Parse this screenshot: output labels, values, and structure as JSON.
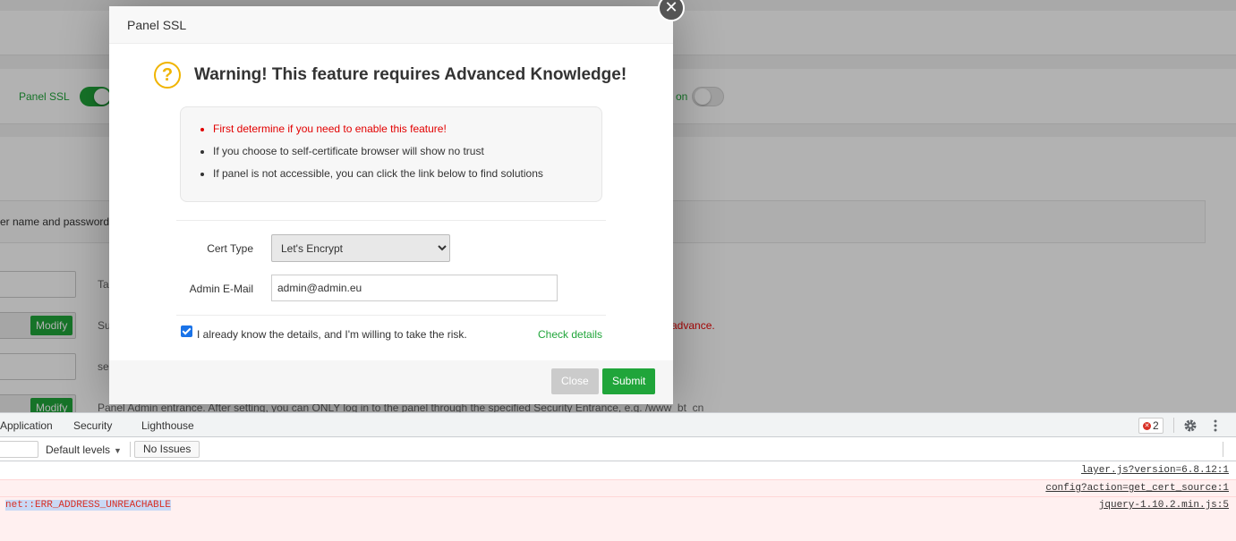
{
  "background": {
    "toggle_label_left": "Panel SSL",
    "toggle_label_right_fragment": "on",
    "tip_text_fragment": "er name and password",
    "desc_row1_fragment": "Ta",
    "desc_row2_fragment": "Su",
    "desc_row3_fragment": "se",
    "desc_row4": "Panel Admin entrance. After setting, you can ONLY log in to the panel through the specified Security Entrance, e.g. /www_bt_cn",
    "advance_fragment": "advance.",
    "modify_label": "Modify"
  },
  "modal": {
    "title": "Panel SSL",
    "close_x": "✕",
    "warning_icon": "?",
    "warning_title": "Warning! This feature requires Advanced Knowledge!",
    "notes": [
      "First determine if you need to enable this feature!",
      "If you choose to self-certificate browser will show no trust",
      "If panel is not accessible, you can click the link below to find solutions"
    ],
    "cert_type_label": "Cert Type",
    "cert_type_value": "Let's Encrypt",
    "admin_email_label": "Admin E-Mail",
    "admin_email_value": "admin@admin.eu",
    "agree_text": "I already know the details, and I'm willing to take the risk.",
    "check_details": "Check details",
    "close_button": "Close",
    "submit_button": "Submit"
  },
  "devtools": {
    "tabs": [
      "Application",
      "Security",
      "Lighthouse"
    ],
    "error_count": "2",
    "default_levels": "Default levels",
    "no_issues": "No Issues",
    "log_rows": [
      {
        "message": "",
        "source": "layer.js?version=6.8.12:1"
      },
      {
        "message": "",
        "source": "config?action=get_cert_source:1"
      },
      {
        "message": "net::ERR_ADDRESS_UNREACHABLE",
        "source": "jquery-1.10.2.min.js:5"
      }
    ]
  },
  "colors": {
    "accent_green": "#20a53a",
    "warning_red": "#e20000",
    "warning_icon": "#f0b400"
  }
}
